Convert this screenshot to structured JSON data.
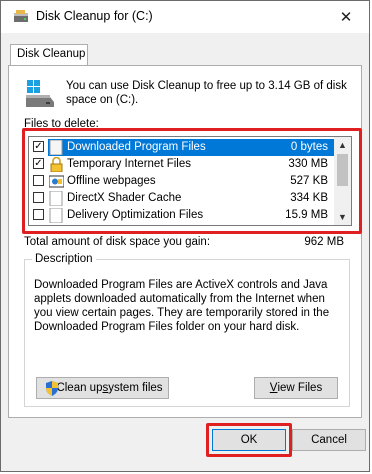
{
  "window": {
    "title": "Disk Cleanup for  (C:)",
    "close_glyph": "✕"
  },
  "tab": {
    "label": "Disk Cleanup"
  },
  "info": {
    "text": "You can use Disk Cleanup to free up to 3.14 GB of disk space on  (C:)."
  },
  "files": {
    "label": "Files to delete:",
    "items": [
      {
        "checked": true,
        "name": "Downloaded Program Files",
        "size": "0 bytes",
        "icon": "blank-file-icon"
      },
      {
        "checked": true,
        "name": "Temporary Internet Files",
        "size": "330 MB",
        "icon": "lock-icon"
      },
      {
        "checked": false,
        "name": "Offline webpages",
        "size": "527 KB",
        "icon": "offline-page-icon"
      },
      {
        "checked": false,
        "name": "DirectX Shader Cache",
        "size": "334 KB",
        "icon": "blank-file-icon"
      },
      {
        "checked": false,
        "name": "Delivery Optimization Files",
        "size": "15.9 MB",
        "icon": "blank-file-icon"
      }
    ],
    "selected_index": 0
  },
  "total": {
    "label": "Total amount of disk space you gain:",
    "value": "962 MB"
  },
  "description": {
    "legend": "Description",
    "text": "Downloaded Program Files are ActiveX controls and Java applets downloaded automatically from the Internet when you view certain pages. They are temporarily stored in the Downloaded Program Files folder on your hard disk."
  },
  "buttons": {
    "cleanup_pre": "Clean up ",
    "cleanup_underline": "s",
    "cleanup_post": "ystem files",
    "view_underline": "V",
    "view_post": "iew Files",
    "ok": "OK",
    "cancel": "Cancel"
  },
  "colors": {
    "selection": "#0078d7",
    "highlight_box": "#e02020"
  }
}
